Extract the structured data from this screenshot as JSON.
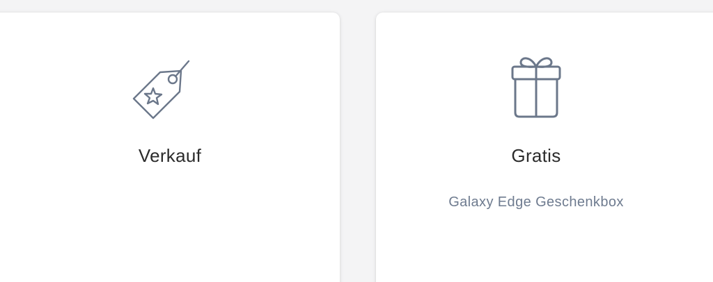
{
  "cards": [
    {
      "icon": "price-tag-star-icon",
      "title": "Verkauf"
    },
    {
      "icon": "gift-box-icon",
      "title": "Gratis",
      "subtitle": "Galaxy Edge Geschenkbox"
    }
  ],
  "colors": {
    "background": "#f4f4f5",
    "card": "#ffffff",
    "icon_stroke": "#6b778a",
    "title_text": "#2b2b2b",
    "subtitle_text": "#6e7b8f"
  }
}
